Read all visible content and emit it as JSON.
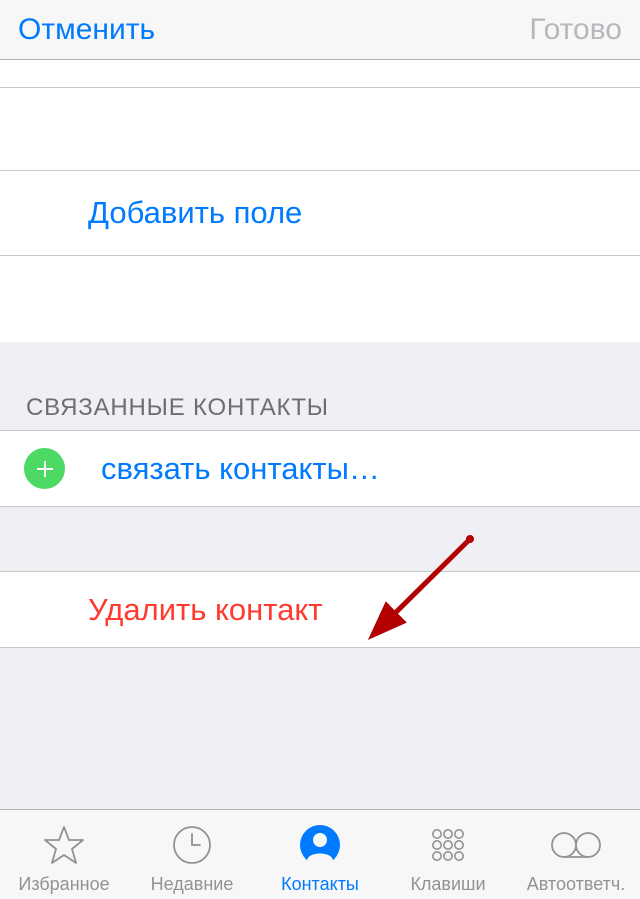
{
  "nav": {
    "cancel": "Отменить",
    "done": "Готово"
  },
  "rows": {
    "add_field": "Добавить поле",
    "link_contacts": "связать контакты…",
    "delete_contact": "Удалить контакт"
  },
  "section": {
    "linked_contacts": "СВЯЗАННЫЕ КОНТАКТЫ"
  },
  "tabs": {
    "favorites": "Избранное",
    "recents": "Недавние",
    "contacts": "Контакты",
    "keypad": "Клавиши",
    "voicemail": "Автоответч."
  }
}
